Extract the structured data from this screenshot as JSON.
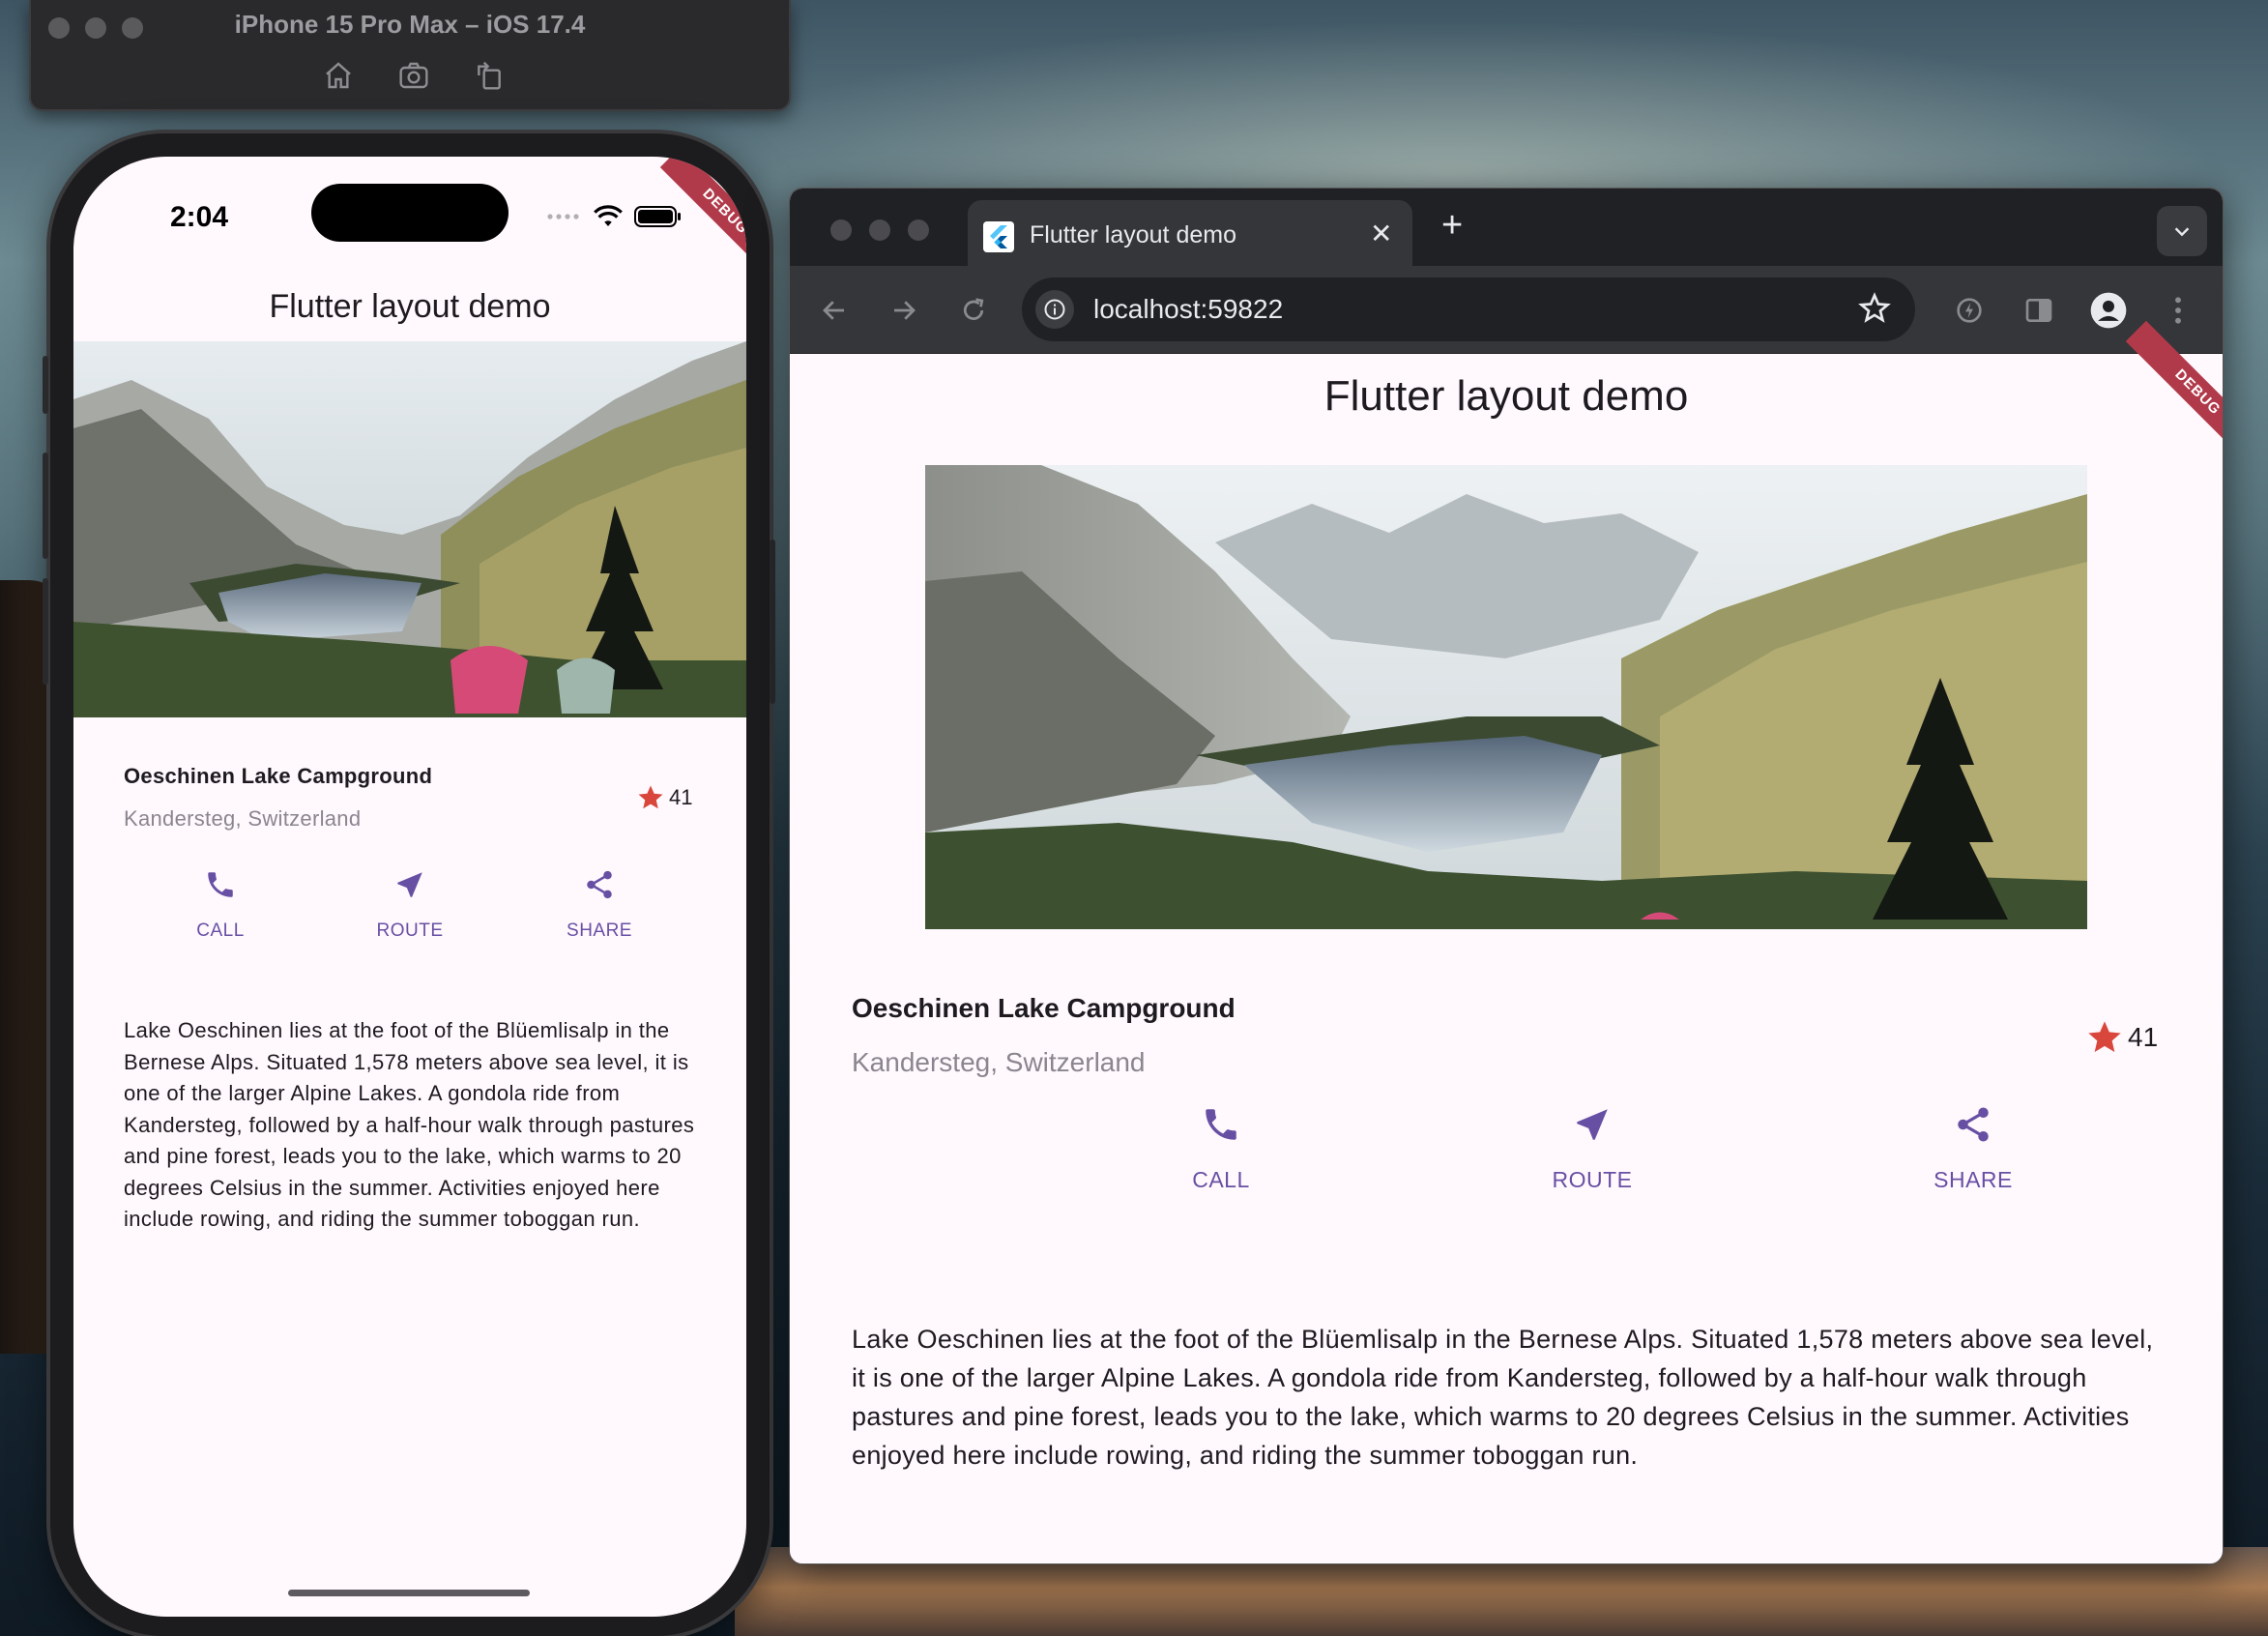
{
  "simulator": {
    "title": "iPhone 15 Pro Max – iOS 17.4",
    "icons": [
      "home-icon",
      "screenshot-icon",
      "rotate-icon"
    ]
  },
  "phone": {
    "status_time": "2:04",
    "debug_label": "DEBUG",
    "app_title": "Flutter layout demo",
    "place_title": "Oeschinen Lake Campground",
    "place_subtitle": "Kandersteg, Switzerland",
    "star_count": "41",
    "buttons": [
      {
        "label": "CALL",
        "icon": "phone-icon"
      },
      {
        "label": "ROUTE",
        "icon": "near-me-icon"
      },
      {
        "label": "SHARE",
        "icon": "share-icon"
      }
    ],
    "description": "Lake Oeschinen lies at the foot of the Blüemlisalp in the Bernese Alps. Situated 1,578 meters above sea level, it is one of the larger Alpine Lakes. A gondola ride from Kandersteg, followed by a half-hour walk through pastures and pine forest, leads you to the lake, which warms to 20 degrees Celsius in the summer. Activities enjoyed here include rowing, and riding the summer toboggan run."
  },
  "browser": {
    "tab_title": "Flutter layout demo",
    "url": "localhost:59822",
    "debug_label": "DEBUG",
    "app_title": "Flutter layout demo",
    "place_title": "Oeschinen Lake Campground",
    "place_subtitle": "Kandersteg, Switzerland",
    "star_count": "41",
    "buttons": [
      {
        "label": "CALL",
        "icon": "phone-icon"
      },
      {
        "label": "ROUTE",
        "icon": "near-me-icon"
      },
      {
        "label": "SHARE",
        "icon": "share-icon"
      }
    ],
    "description": "Lake Oeschinen lies at the foot of the Blüemlisalp in the Bernese Alps. Situated 1,578 meters above sea level, it is one of the larger Alpine Lakes. A gondola ride from Kandersteg, followed by a half-hour walk through pastures and pine forest, leads you to the lake, which warms to 20 degrees Celsius in the summer. Activities enjoyed here include rowing, and riding the summer toboggan run."
  },
  "colors": {
    "accent": "#6750a4",
    "star": "#d9463b",
    "debug_banner": "#b13a4a",
    "surface": "#fff8fd"
  }
}
